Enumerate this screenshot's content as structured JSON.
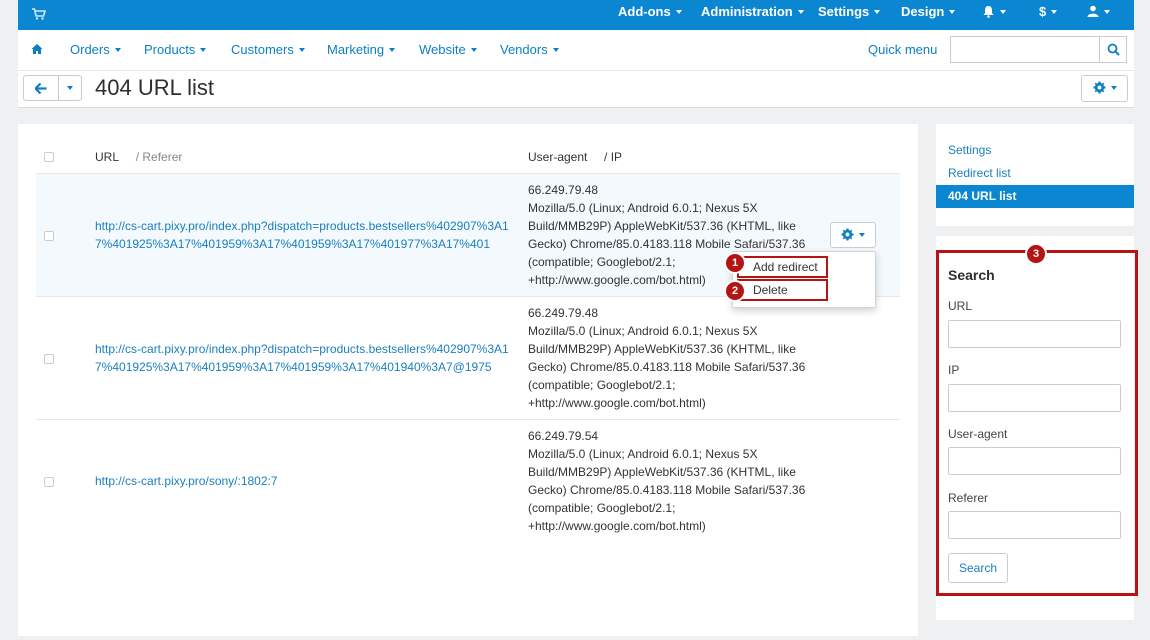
{
  "topbar": {
    "addons": "Add-ons",
    "administration": "Administration",
    "settings": "Settings",
    "design": "Design",
    "currency": "$"
  },
  "nav": {
    "items": [
      "Orders",
      "Products",
      "Customers",
      "Marketing",
      "Website",
      "Vendors"
    ],
    "quick_menu": "Quick menu",
    "search_value": ""
  },
  "page": {
    "title": "404 URL list"
  },
  "table": {
    "col_url": "URL",
    "col_referer": "/ Referer",
    "col_useragent": "User-agent",
    "col_ip": "/ IP",
    "rows": [
      {
        "url": "http://cs-cart.pixy.pro/index.php?dispatch=products.bestsellers%402907%3A17%401925%3A17%401959%3A17%401959%3A17%401977%3A17%401",
        "ip": "66.249.79.48",
        "user_agent": "Mozilla/5.0 (Linux; Android 6.0.1; Nexus 5X Build/MMB29P) AppleWebKit/537.36 (KHTML, like Gecko) Chrome/85.0.4183.118 Mobile Safari/537.36 (compatible; Googlebot/2.1; +http://www.google.com/bot.html)"
      },
      {
        "url": "http://cs-cart.pixy.pro/index.php?dispatch=products.bestsellers%402907%3A17%401925%3A17%401959%3A17%401959%3A17%401940%3A7@1975",
        "ip": "66.249.79.48",
        "user_agent": "Mozilla/5.0 (Linux; Android 6.0.1; Nexus 5X Build/MMB29P) AppleWebKit/537.36 (KHTML, like Gecko) Chrome/85.0.4183.118 Mobile Safari/537.36 (compatible; Googlebot/2.1; +http://www.google.com/bot.html)"
      },
      {
        "url": "http://cs-cart.pixy.pro/sony/:1802:7",
        "ip": "66.249.79.54",
        "user_agent": "Mozilla/5.0 (Linux; Android 6.0.1; Nexus 5X Build/MMB29P) AppleWebKit/537.36 (KHTML, like Gecko) Chrome/85.0.4183.118 Mobile Safari/537.36 (compatible; Googlebot/2.1; +http://www.google.com/bot.html)"
      }
    ]
  },
  "dropdown": {
    "add_redirect": "Add redirect",
    "delete": "Delete"
  },
  "annotations": {
    "one": "1",
    "two": "2",
    "three": "3"
  },
  "sidebar": {
    "menu": [
      "Settings",
      "Redirect list",
      "404 URL list"
    ],
    "active_index": 2
  },
  "search": {
    "title": "Search",
    "url_label": "URL",
    "ip_label": "IP",
    "useragent_label": "User-agent",
    "referer_label": "Referer",
    "button": "Search"
  },
  "colors": {
    "brand": "#0b87d2",
    "annotation": "#b41414"
  }
}
